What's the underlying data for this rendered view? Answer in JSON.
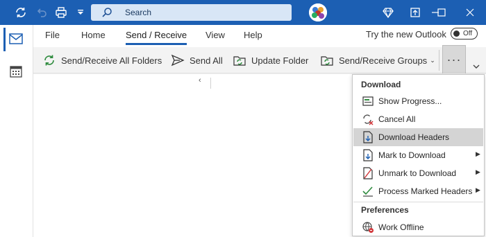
{
  "titlebar": {
    "search_placeholder": "Search",
    "accent": "#1c5fb3",
    "icons": [
      "sync-icon",
      "undo-icon",
      "print-icon",
      "quick-access-dropdown-icon",
      "search-icon",
      "diamond-icon",
      "restore-icon",
      "minimize-icon",
      "maximize-icon",
      "close-icon"
    ]
  },
  "tabs": [
    {
      "label": "File"
    },
    {
      "label": "Home"
    },
    {
      "label": "Send / Receive"
    },
    {
      "label": "View"
    },
    {
      "label": "Help"
    }
  ],
  "try_new": {
    "label": "Try the new Outlook",
    "toggle": "Off"
  },
  "commands": [
    {
      "label": "Send/Receive All Folders",
      "icon": "send-receive-icon"
    },
    {
      "label": "Send All",
      "icon": "send-icon"
    },
    {
      "label": "Update Folder",
      "icon": "update-folder-icon"
    },
    {
      "label": "Send/Receive Groups",
      "icon": "groups-icon"
    }
  ],
  "more_label": "···",
  "menu": {
    "section1": "Download",
    "items": [
      {
        "label": "Show Progress...",
        "icon": "progress-icon"
      },
      {
        "label": "Cancel All",
        "icon": "cancel-all-icon"
      },
      {
        "label": "Download Headers",
        "icon": "download-headers-icon"
      },
      {
        "label": "Mark to Download",
        "icon": "mark-download-icon"
      },
      {
        "label": "Unmark to Download",
        "icon": "unmark-download-icon"
      },
      {
        "label": "Process Marked Headers",
        "icon": "process-headers-icon"
      }
    ],
    "section2": "Preferences",
    "work_offline": "Work Offline"
  }
}
